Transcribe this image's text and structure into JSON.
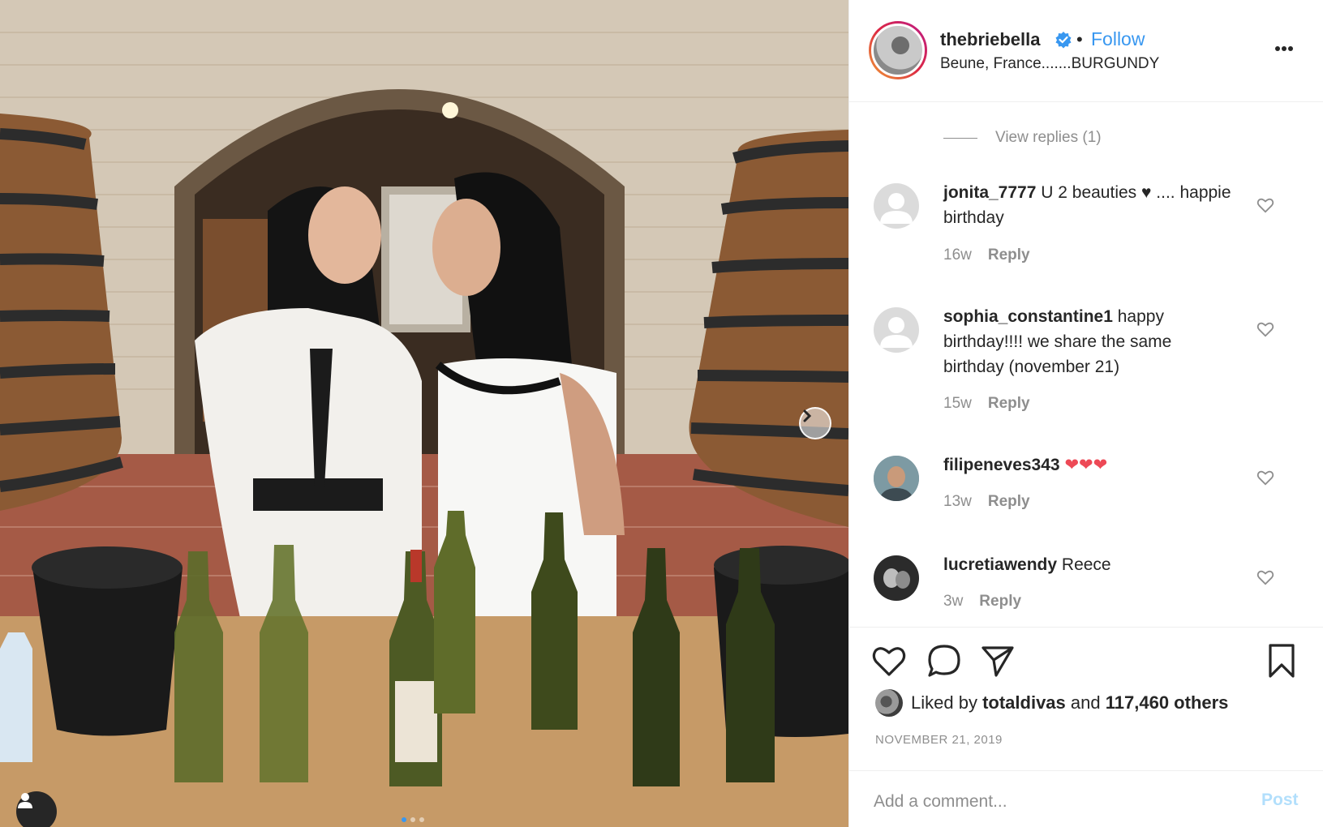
{
  "post": {
    "username": "thebriebella",
    "follow_label": "Follow",
    "separator": "•",
    "location": "Beune, France.......BURGUNDY",
    "more_icon": "more-horizontal-icon"
  },
  "comments": {
    "view_replies": "View replies (1)",
    "items": [
      {
        "username": "jonita_7777",
        "text": "U 2 beauties ♥ .... happie birthday",
        "age": "16w",
        "reply": "Reply"
      },
      {
        "username": "sophia_constantine1",
        "text": "happy birthday!!!! we share the same birthday (november 21)",
        "age": "15w",
        "reply": "Reply"
      },
      {
        "username": "filipeneves343",
        "text": "❤❤❤",
        "age": "13w",
        "reply": "Reply"
      },
      {
        "username": "lucretiawendy",
        "text": "Reece",
        "age": "3w",
        "reply": "Reply"
      }
    ]
  },
  "actions": {
    "liked_by_prefix": "Liked by",
    "liked_by_user": "totaldivas",
    "liked_by_and": "and",
    "liked_by_count": "117,460 others",
    "date": "NOVEMBER 21, 2019"
  },
  "add_comment": {
    "placeholder": "Add a comment...",
    "post_label": "Post"
  },
  "colors": {
    "link_blue": "#3897f0",
    "muted": "#8e8e8e",
    "post_disabled": "#b2dffc"
  }
}
